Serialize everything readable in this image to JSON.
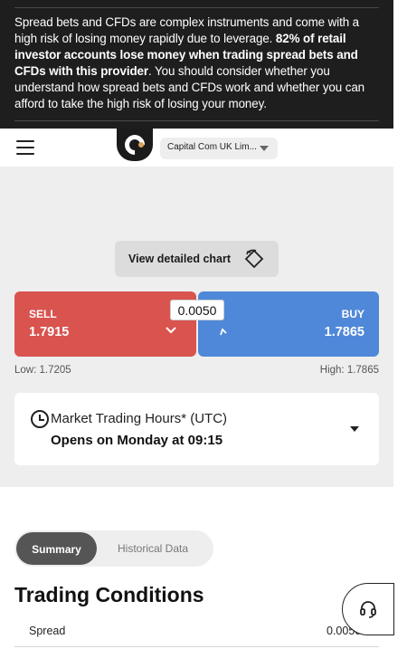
{
  "risk_warning": {
    "text_start": "Spread bets and CFDs are complex instruments and come with a high risk of losing money rapidly due to leverage. ",
    "text_bold": "82% of retail investor accounts lose money when trading spread bets and CFDs with this provider",
    "text_end": ". You should consider whether you understand how spread bets and CFDs work and whether you can afford to take the high risk of losing your money."
  },
  "header": {
    "menu_icon": "hamburger-icon",
    "logo": "capital-com-logo",
    "entity_selected": "Capital Com UK Lim..."
  },
  "chart": {
    "button_label": "View detailed chart"
  },
  "trade": {
    "sell_label": "SELL",
    "sell_price": "1.7915",
    "buy_label": "BUY",
    "buy_price": "1.7865",
    "spread": "0.0050",
    "low": "Low: 1.7205",
    "high": "High: 1.7865",
    "colors": {
      "sell": "#d9534f",
      "buy": "#4f88d8"
    }
  },
  "hours": {
    "title": "Market Trading Hours* (UTC)",
    "subtitle": "Opens on Monday at 09:15"
  },
  "tabs": [
    {
      "label": "Summary",
      "active": true
    },
    {
      "label": "Historical Data",
      "active": false
    }
  ],
  "trading_conditions": {
    "title": "Trading Conditions",
    "rows": [
      {
        "label": "Spread",
        "value": "0.0050"
      }
    ]
  },
  "support": {
    "icon": "headset-icon"
  }
}
